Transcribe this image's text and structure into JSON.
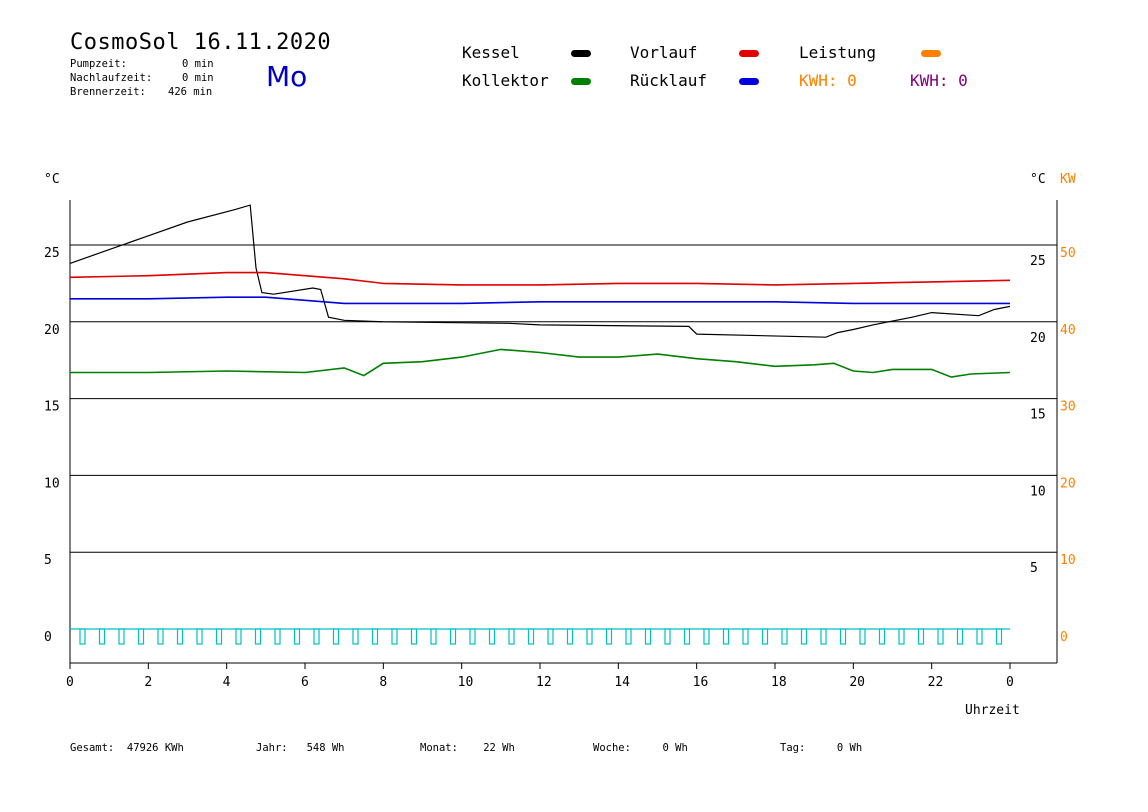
{
  "header": {
    "title": "CosmoSol 16.11.2020",
    "day": "Mo",
    "stats": [
      {
        "label": "Pumpzeit:",
        "value": "0 min"
      },
      {
        "label": "Nachlaufzeit:",
        "value": "0 min"
      },
      {
        "label": "Brennerzeit:",
        "value": "426 min"
      }
    ]
  },
  "legend": {
    "kessel": "Kessel",
    "kollektor": "Kollektor",
    "vorlauf": "Vorlauf",
    "ruecklauf": "Rücklauf",
    "leistung": "Leistung",
    "kwh_orange": "KWH: 0",
    "kwh_purple": "KWH: 0"
  },
  "colors": {
    "kessel": "#000000",
    "kollektor": "#008000",
    "vorlauf": "#e00000",
    "ruecklauf": "#0000e0",
    "leistung": "#ff8000",
    "kwh_purple": "#800080",
    "pump": "#00c0c0",
    "day": "#0000c0"
  },
  "footer": {
    "gesamt": "Gesamt:  47926 KWh",
    "jahr": "Jahr:   548 Wh",
    "monat": "Monat:    22 Wh",
    "woche": "Woche:     0 Wh",
    "tag": "Tag:     0 Wh"
  },
  "chart_data": {
    "type": "line",
    "xlabel": "Uhrzeit",
    "ylabel_left": "°C",
    "ylabel_right_1": "°C",
    "ylabel_right_2": "KW",
    "xlim": [
      0,
      24
    ],
    "ylim": [
      -2,
      29
    ],
    "x_tick_labels": [
      "0",
      "2",
      "4",
      "6",
      "8",
      "10",
      "12",
      "14",
      "16",
      "18",
      "20",
      "22",
      "0"
    ],
    "y_left_ticks": [
      0,
      5,
      10,
      15,
      20,
      25
    ],
    "y_right_temp_ticks": [
      5,
      10,
      15,
      20,
      25
    ],
    "y_right_kw_ticks": [
      0,
      10,
      20,
      30,
      40,
      50
    ],
    "grid": "horizontal",
    "series": [
      {
        "name": "Kessel",
        "color_key": "kessel",
        "points": [
          [
            0,
            23.8
          ],
          [
            1,
            24.7
          ],
          [
            2,
            25.6
          ],
          [
            3,
            26.5
          ],
          [
            4.2,
            27.3
          ],
          [
            4.6,
            27.6
          ],
          [
            4.75,
            23.5
          ],
          [
            4.9,
            21.9
          ],
          [
            5.2,
            21.8
          ],
          [
            6.2,
            22.2
          ],
          [
            6.4,
            22.1
          ],
          [
            6.6,
            20.3
          ],
          [
            7,
            20.1
          ],
          [
            8,
            20
          ],
          [
            11.2,
            19.9
          ],
          [
            12,
            19.8
          ],
          [
            15.8,
            19.7
          ],
          [
            16,
            19.2
          ],
          [
            19.3,
            19.0
          ],
          [
            19.6,
            19.3
          ],
          [
            20,
            19.5
          ],
          [
            20.5,
            19.8
          ],
          [
            21.5,
            20.3
          ],
          [
            22,
            20.6
          ],
          [
            23.2,
            20.4
          ],
          [
            23.6,
            20.8
          ],
          [
            24,
            21.0
          ]
        ]
      },
      {
        "name": "Vorlauf",
        "color_key": "vorlauf",
        "points": [
          [
            0,
            22.9
          ],
          [
            2,
            23.0
          ],
          [
            4,
            23.2
          ],
          [
            5,
            23.2
          ],
          [
            6,
            23.0
          ],
          [
            7,
            22.8
          ],
          [
            8,
            22.5
          ],
          [
            10,
            22.4
          ],
          [
            12,
            22.4
          ],
          [
            14,
            22.5
          ],
          [
            16,
            22.5
          ],
          [
            18,
            22.4
          ],
          [
            20,
            22.5
          ],
          [
            22,
            22.6
          ],
          [
            24,
            22.7
          ]
        ]
      },
      {
        "name": "Rücklauf",
        "color_key": "ruecklauf",
        "points": [
          [
            0,
            21.5
          ],
          [
            2,
            21.5
          ],
          [
            4,
            21.6
          ],
          [
            5,
            21.6
          ],
          [
            6,
            21.4
          ],
          [
            7,
            21.2
          ],
          [
            8,
            21.2
          ],
          [
            10,
            21.2
          ],
          [
            12,
            21.3
          ],
          [
            14,
            21.3
          ],
          [
            16,
            21.3
          ],
          [
            18,
            21.3
          ],
          [
            20,
            21.2
          ],
          [
            22,
            21.2
          ],
          [
            24,
            21.2
          ]
        ]
      },
      {
        "name": "Kollektor",
        "color_key": "kollektor",
        "points": [
          [
            0,
            16.7
          ],
          [
            2,
            16.7
          ],
          [
            4,
            16.8
          ],
          [
            6,
            16.7
          ],
          [
            7,
            17.0
          ],
          [
            7.5,
            16.5
          ],
          [
            8,
            17.3
          ],
          [
            9,
            17.4
          ],
          [
            10,
            17.7
          ],
          [
            11,
            18.2
          ],
          [
            12,
            18.0
          ],
          [
            13,
            17.7
          ],
          [
            14,
            17.7
          ],
          [
            15,
            17.9
          ],
          [
            16,
            17.6
          ],
          [
            17,
            17.4
          ],
          [
            18,
            17.1
          ],
          [
            19,
            17.2
          ],
          [
            19.5,
            17.3
          ],
          [
            20,
            16.8
          ],
          [
            20.5,
            16.7
          ],
          [
            21,
            16.9
          ],
          [
            22,
            16.9
          ],
          [
            22.5,
            16.4
          ],
          [
            23,
            16.6
          ],
          [
            24,
            16.7
          ]
        ]
      }
    ]
  }
}
